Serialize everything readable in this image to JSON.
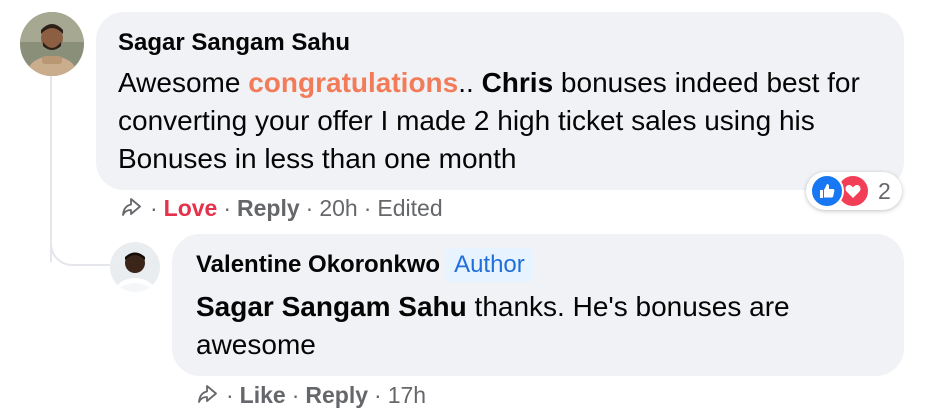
{
  "comment": {
    "author": "Sagar Sangam Sahu",
    "text_part1": "Awesome ",
    "text_highlight": "congratulations",
    "text_part2": ".. ",
    "text_bold": "Chris",
    "text_part3": " bonuses indeed best for converting your offer I made 2 high ticket sales using his Bonuses in less than one month",
    "reaction_label": "Love",
    "reply_label": "Reply",
    "time": "20h",
    "edited_label": "Edited",
    "reaction_count": "2",
    "reaction_icons": [
      "like-icon",
      "love-icon"
    ]
  },
  "reply": {
    "author": "Valentine Okoronkwo",
    "badge": "Author",
    "mention": "Sagar Sangam Sahu",
    "text": " thanks. He's bonuses are awesome",
    "like_label": "Like",
    "reply_label": "Reply",
    "time": "17h"
  },
  "separator": "·",
  "colors": {
    "bubble_bg": "#f0f2f5",
    "highlight": "#f27c5a",
    "love": "#e4324c",
    "badge_bg": "#e7f3ff",
    "badge_text": "#216fdb",
    "meta_text": "#65676b",
    "like_blue": "#1877f2",
    "love_red": "#f33e58"
  }
}
